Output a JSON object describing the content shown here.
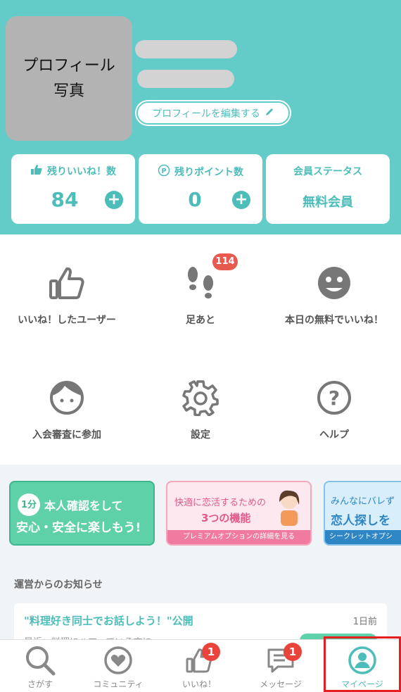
{
  "profile": {
    "photo_text": "プロフィール\n写真",
    "edit_button": "プロフィールを編集する"
  },
  "stats": {
    "likes_left_label": "残りいいね！数",
    "likes_left_value": "84",
    "points_label": "残りポイント数",
    "points_value": "0",
    "member_status_label": "会員ステータス",
    "member_status_value": "無料会員"
  },
  "menu": {
    "items": [
      {
        "label": "いいね！したユーザー",
        "icon": "thumbs-up-icon"
      },
      {
        "label": "足あと",
        "icon": "footprints-icon"
      },
      {
        "label": "本日の無料でいいね！",
        "icon": "free-like-icon"
      },
      {
        "label": "入会審査に参加",
        "icon": "face-icon"
      },
      {
        "label": "設定",
        "icon": "gear-icon"
      },
      {
        "label": "ヘルプ",
        "icon": "help-icon"
      }
    ],
    "footprints_badge": "114"
  },
  "banners": [
    {
      "small": "1分",
      "line1": "本人確認をして",
      "line2": "安心・安全に楽しもう!"
    },
    {
      "line1": "快適に恋活するための",
      "line2": "3つの機能",
      "footer": "プレミアムオプションの詳細を見る"
    },
    {
      "line1": "みんなにバレず",
      "line2": "恋人探しを",
      "footer": "シークレットオプシ"
    }
  ],
  "news": {
    "heading": "運営からのお知らせ",
    "title": "\"料理好き同士でお話しよう！\"公開",
    "time": "1日前",
    "snippet": "最近、料理にハマっている方に..."
  },
  "nav": {
    "items": [
      {
        "label": "さがす",
        "icon": "search-icon"
      },
      {
        "label": "コミュニティ",
        "icon": "community-icon"
      },
      {
        "label": "いいね！",
        "icon": "like-icon",
        "badge": "1"
      },
      {
        "label": "メッセージ",
        "icon": "message-icon",
        "badge": "1"
      },
      {
        "label": "マイページ",
        "icon": "mypage-icon"
      }
    ]
  },
  "colors": {
    "accent": "#63cbc8",
    "accent_dark": "#4dbdb9",
    "badge_red": "#e8443b",
    "highlight": "#e51f1f"
  }
}
